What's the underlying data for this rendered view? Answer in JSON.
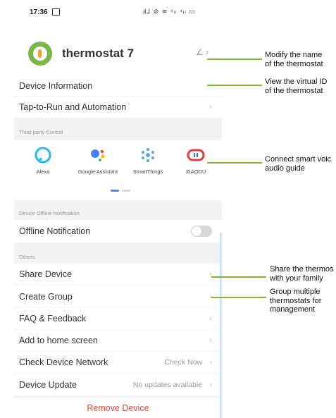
{
  "status_bar": {
    "time": "17:36",
    "icons": "Ⅎ⅃ ⊘ ≋ ⁴ᵢₗ ⁴ᵢₗ ▭"
  },
  "header": {
    "device_name": "thermostat 7",
    "edit_glyph": "∠ ›"
  },
  "rows": {
    "device_information": "Device Information",
    "tap_to_run": "Tap-to-Run and Automation",
    "offline_notification": "Offline Notification",
    "share_device": "Share Device",
    "create_group": "Create Group",
    "faq_feedback": "FAQ & Feedback",
    "add_home_screen": "Add to home screen",
    "check_network": "Check Device Network",
    "check_network_value": "Check Now",
    "device_update": "Device Update",
    "device_update_value": "No updates available",
    "chevron": "›"
  },
  "sections": {
    "third_party": "Third-party Control",
    "offline": "Device Offline Notification",
    "others": "Others"
  },
  "third_party": [
    {
      "name": "Alexa",
      "icon": "alexa-icon"
    },
    {
      "name": "Google Assistant",
      "icon": "google-assistant-icon"
    },
    {
      "name": "SmartThings",
      "icon": "smartthings-icon"
    },
    {
      "name": "XIAODU",
      "icon": "xiaodu-icon"
    }
  ],
  "remove_label": "Remove Device",
  "offline_toggle_on": false,
  "callouts": {
    "modify_name": "Modify the name\nof the thermostat",
    "view_id": "View the virtual ID\nof the thermostat",
    "connect_voice": "Connect smart voic\naudio guide",
    "share": "Share the thermos\nwith your family",
    "group": "Group multiple\nthermostats for\nmanagement"
  },
  "colors": {
    "accent_green": "#79b93b",
    "remove_red": "#e0483f",
    "dot_active": "#3f8dfb"
  }
}
